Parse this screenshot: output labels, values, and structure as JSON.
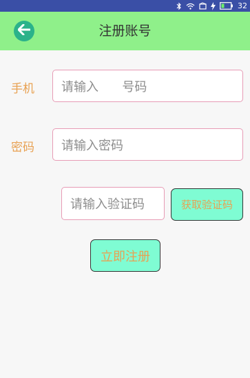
{
  "status_bar": {
    "time": "32"
  },
  "header": {
    "title": "注册账号"
  },
  "form": {
    "phone_label": "手机",
    "phone_placeholder": "请输入      号码",
    "password_label": "密码",
    "password_placeholder": "请输入密码",
    "code_placeholder": "请输入验证码",
    "get_code_label": "获取验证码",
    "register_label": "立即注册"
  },
  "colors": {
    "status_bar": "#3a4fa6",
    "app_bar": "#8ff08a",
    "accent_label": "#e8a152",
    "field_border": "#e79bb5",
    "button_bg": "#7ffcd3",
    "back_icon_bg": "#2bb28a"
  }
}
